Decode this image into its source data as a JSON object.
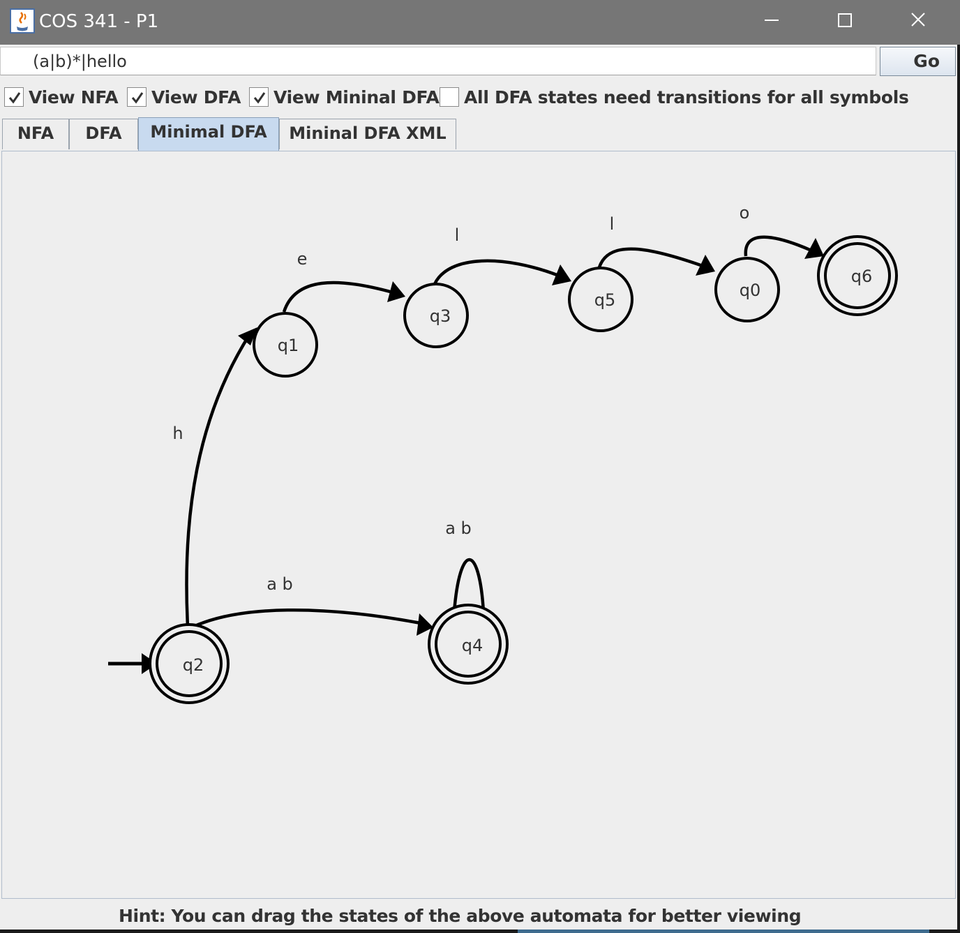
{
  "window": {
    "title": "COS 341 - P1",
    "icon": "java-cup-icon",
    "controls": [
      "minimize-icon",
      "maximize-icon",
      "close-icon"
    ]
  },
  "input": {
    "regex_value": "(a|b)*|hello",
    "go_label": "Go"
  },
  "options": {
    "view_nfa": {
      "label": "View NFA",
      "checked": true
    },
    "view_dfa": {
      "label": "View DFA",
      "checked": true
    },
    "view_min_dfa": {
      "label": "View Mininal DFA",
      "checked": true
    },
    "all_transitions": {
      "label": "All DFA states need transitions for all symbols",
      "checked": false
    }
  },
  "tabs": [
    {
      "label": "NFA",
      "active": false
    },
    {
      "label": "DFA",
      "active": false
    },
    {
      "label": "Minimal DFA",
      "active": true
    },
    {
      "label": "Mininal DFA XML",
      "active": false
    }
  ],
  "automaton": {
    "start_state": "q2",
    "accepting_states": [
      "q2",
      "q4",
      "q6"
    ],
    "states": {
      "q0": "q0",
      "q1": "q1",
      "q2": "q2",
      "q3": "q3",
      "q4": "q4",
      "q5": "q5",
      "q6": "q6"
    },
    "transitions": [
      {
        "from": "q2",
        "to": "q1",
        "label": "h"
      },
      {
        "from": "q1",
        "to": "q3",
        "label": "e"
      },
      {
        "from": "q3",
        "to": "q5",
        "label": "l"
      },
      {
        "from": "q5",
        "to": "q0",
        "label": "l"
      },
      {
        "from": "q0",
        "to": "q6",
        "label": "o"
      },
      {
        "from": "q2",
        "to": "q4",
        "label": "a b"
      },
      {
        "from": "q4",
        "to": "q4",
        "label": "a b"
      }
    ]
  },
  "hint": "Hint: You can drag the states of the above automata for better viewing",
  "colors": {
    "titlebar": "#767676",
    "panel": "#eeeeee",
    "active_tab": "#c8daef",
    "graph_stroke": "#000000"
  }
}
